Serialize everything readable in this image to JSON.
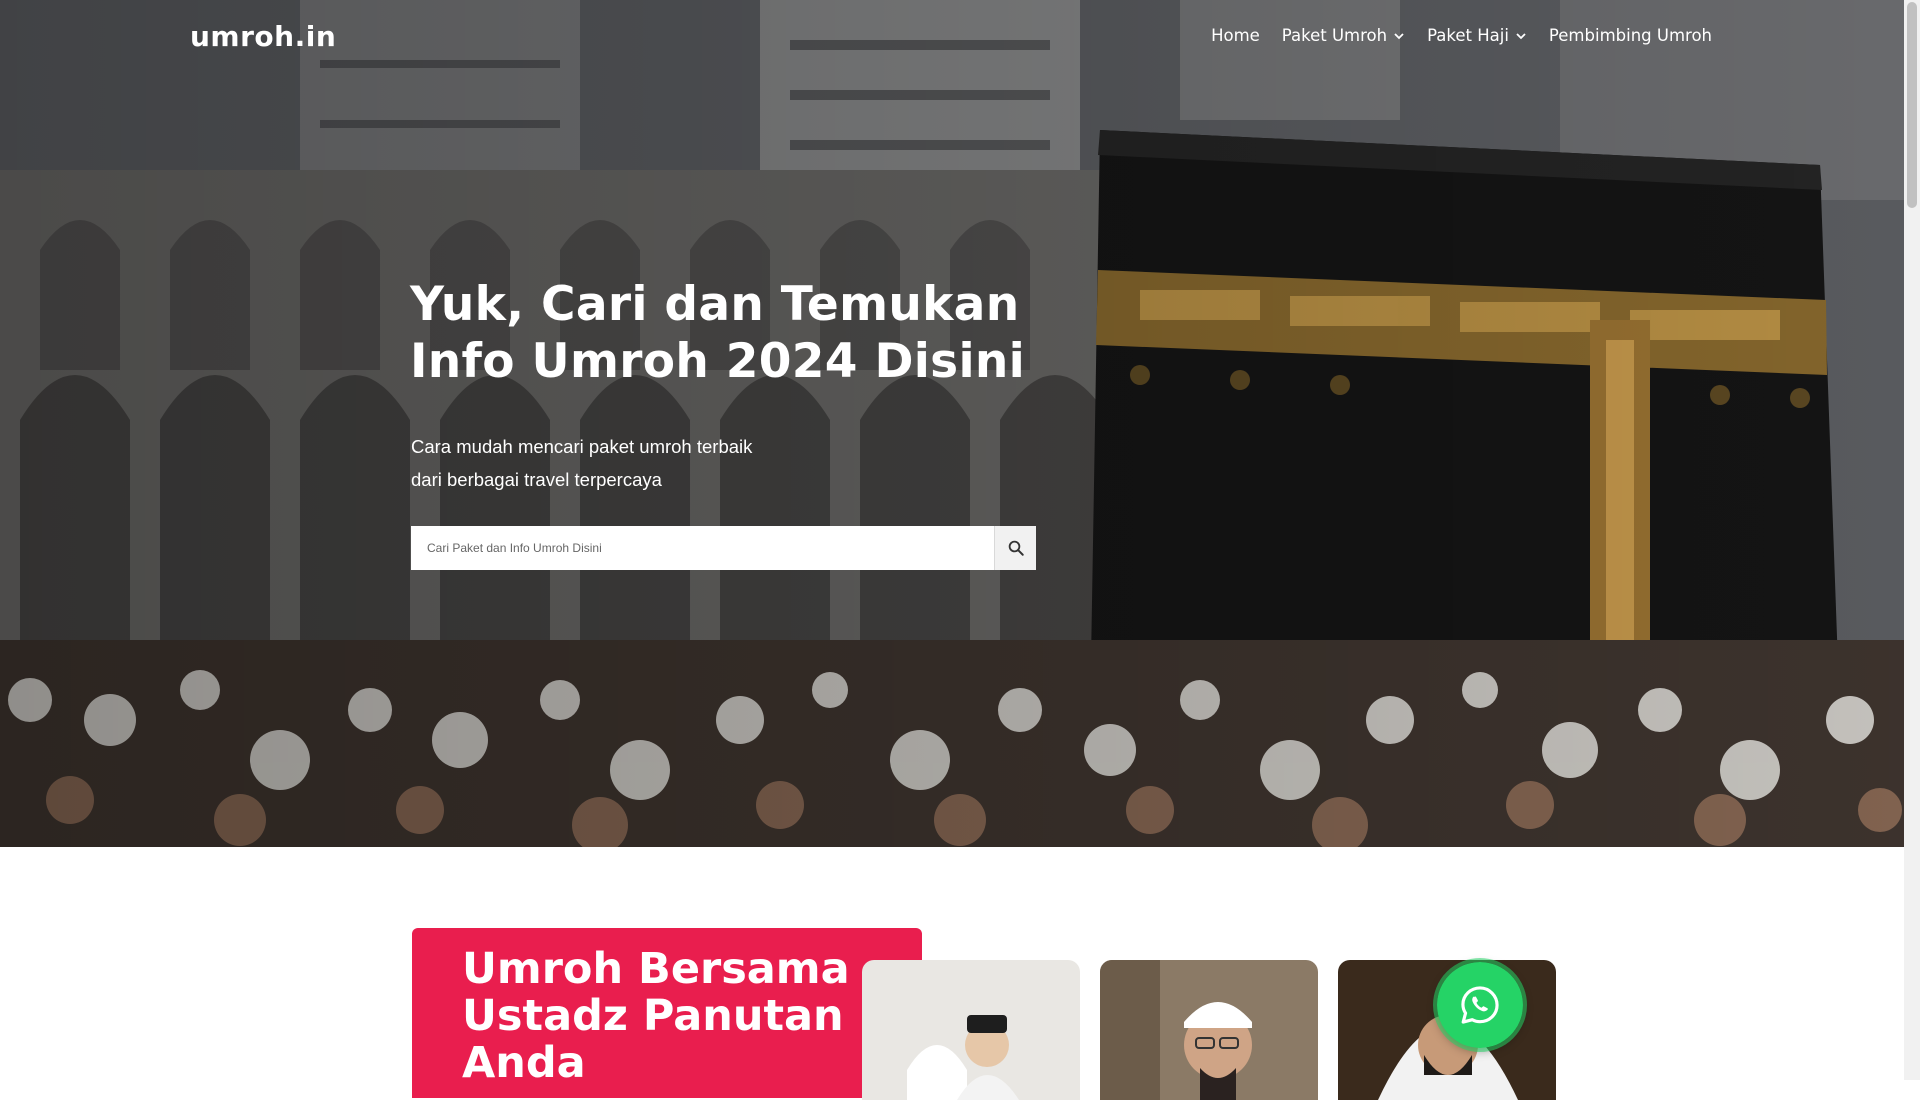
{
  "site": {
    "logo_text": "umroh.in"
  },
  "nav": {
    "items": [
      {
        "label": "Home",
        "has_dropdown": false
      },
      {
        "label": "Paket Umroh",
        "has_dropdown": true
      },
      {
        "label": "Paket Haji",
        "has_dropdown": true
      },
      {
        "label": "Pembimbing Umroh",
        "has_dropdown": false
      }
    ]
  },
  "hero": {
    "title_line1": "Yuk, Cari dan Temukan",
    "title_line2": "Info Umroh 2024 Disini",
    "subtitle_line1": "Cara mudah mencari paket umroh terbaik",
    "subtitle_line2": "dari berbagai travel terpercaya",
    "background": "kaaba-crowd-photo"
  },
  "search": {
    "placeholder": "Cari Paket dan Info Umroh Disini",
    "value": "",
    "button_icon": "search-icon"
  },
  "promo": {
    "title_line1": "Umroh Bersama",
    "title_line2": "Ustadz Panutan",
    "title_line3": "Anda",
    "cards": [
      {
        "icon": "couple-photo"
      },
      {
        "icon": "ustadz-photo"
      },
      {
        "icon": "ustadz-photo"
      }
    ]
  },
  "whatsapp": {
    "icon": "whatsapp-icon"
  },
  "colors": {
    "accent": "#e91e4e",
    "whatsapp": "#25d366",
    "text_on_dark": "#ffffff"
  }
}
